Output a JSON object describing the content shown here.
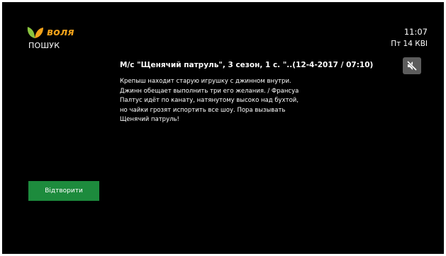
{
  "header": {
    "brand": "воля",
    "section_title": "ПОШУК",
    "time": "11:07",
    "date": "Пт 14 КВІ"
  },
  "program": {
    "title": "М/с \"Щенячий патруль\", 3 сезон, 1 с. \"..(12-4-2017 / 07:10)",
    "description_lines": [
      "Крепыш находит старую игрушку с джинном внутри.",
      "Джинн обещает выполнить три его желания. / Франсуа",
      "Палтус идёт по канату, натянутому высоко над бухтой,",
      "но чайки грозят испортить все шоу. Пора вызывать",
      "Щенячий патруль!"
    ]
  },
  "controls": {
    "mute_icon": "muted-speaker-icon",
    "play_label": "Відтворити"
  },
  "colors": {
    "background": "#000000",
    "accent_green": "#1d8b3d",
    "brand_orange": "#f2a21a",
    "mute_button_bg": "#5c5c5c"
  }
}
